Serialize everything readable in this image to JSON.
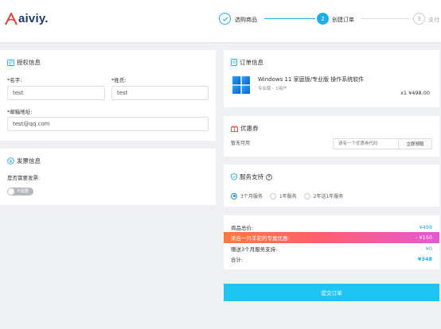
{
  "brand": {
    "name": "aiviy."
  },
  "steps": [
    {
      "num": "",
      "label": "选购商品",
      "state": "done"
    },
    {
      "num": "2",
      "label": "创建订单",
      "state": "active"
    },
    {
      "num": "3",
      "label": "支付",
      "state": "todo"
    }
  ],
  "license": {
    "title": "授权信息",
    "first_name_label": "*名字:",
    "first_name_value": "test",
    "last_name_label": "*姓氏:",
    "last_name_value": "test",
    "email_label": "*邮箱地址:",
    "email_value": "test@qq.com"
  },
  "invoice": {
    "title": "发票信息",
    "question": "是否需要发票:",
    "toggle_text": "不需要",
    "toggle_on": false
  },
  "order": {
    "title": "订单信息",
    "product_name": "Windows 11 家庭版/专业版 操作系统软件",
    "product_sub": "专业版 - 1用户",
    "price": "x1 ¥498.00"
  },
  "coupon": {
    "title": "优惠券",
    "status": "暂无可用",
    "placeholder": "请有一个优惠券代码",
    "redeem_label": "立即领取"
  },
  "service": {
    "title": "服务支持",
    "options": [
      "3个月服务",
      "1年服务",
      "2年送1年服务"
    ],
    "selected_index": 0
  },
  "summary": {
    "subtotal_label": "商品总价:",
    "subtotal_value": "¥498",
    "promo_label": "来自一只羊驼的专属优惠:",
    "promo_value": "- ¥150",
    "gift_label": "赠送3个月服务支持:",
    "gift_value": "¥0",
    "total_label": "合计:",
    "total_value": "¥348"
  },
  "submit_label": "提交订单",
  "colors": {
    "accent": "#1eaee8",
    "submit": "#1fc5f2",
    "promo_start": "#ff7a3a",
    "promo_end": "#e45ad6",
    "logo_red": "#e2433f"
  }
}
